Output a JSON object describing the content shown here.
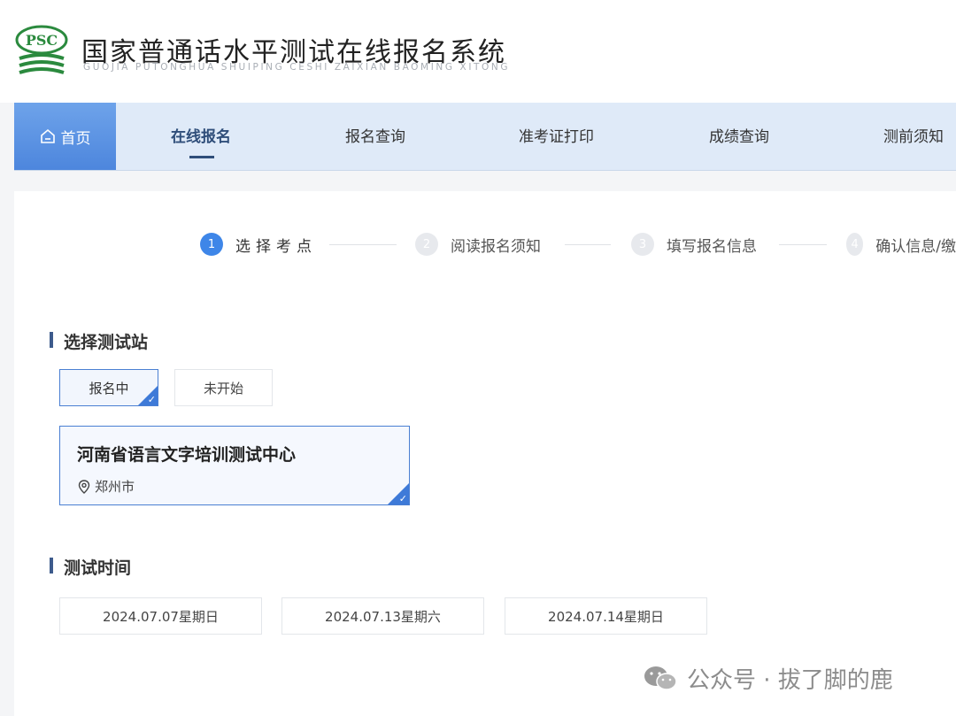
{
  "header": {
    "logo_text": "PSC",
    "title": "国家普通话水平测试在线报名系统",
    "subtitle": "GUOJIA PUTONGHUA SHUIPING CESHI ZAIXIAN BAOMING XITONG"
  },
  "nav": {
    "home": "首页",
    "items": [
      "在线报名",
      "报名查询",
      "准考证打印",
      "成绩查询",
      "测前须知"
    ],
    "active_index": 0
  },
  "steps": [
    {
      "num": "1",
      "label": "选择考点",
      "active": true
    },
    {
      "num": "2",
      "label": "阅读报名须知",
      "active": false
    },
    {
      "num": "3",
      "label": "填写报名信息",
      "active": false
    },
    {
      "num": "4",
      "label": "确认信息/缴",
      "active": false
    }
  ],
  "station_section": {
    "title": "选择测试站",
    "tabs": [
      "报名中",
      "未开始"
    ],
    "selected_tab": 0,
    "center": {
      "name": "河南省语言文字培训测试中心",
      "city": "郑州市"
    }
  },
  "time_section": {
    "title": "测试时间",
    "dates": [
      "2024.07.07星期日",
      "2024.07.13星期六",
      "2024.07.14星期日"
    ]
  },
  "watermark": {
    "text": "公众号 · 拔了脚的鹿"
  },
  "colors": {
    "accent": "#3e86e8",
    "nav_bg": "#dfeaf8",
    "nav_active": "#2f4e7a"
  }
}
